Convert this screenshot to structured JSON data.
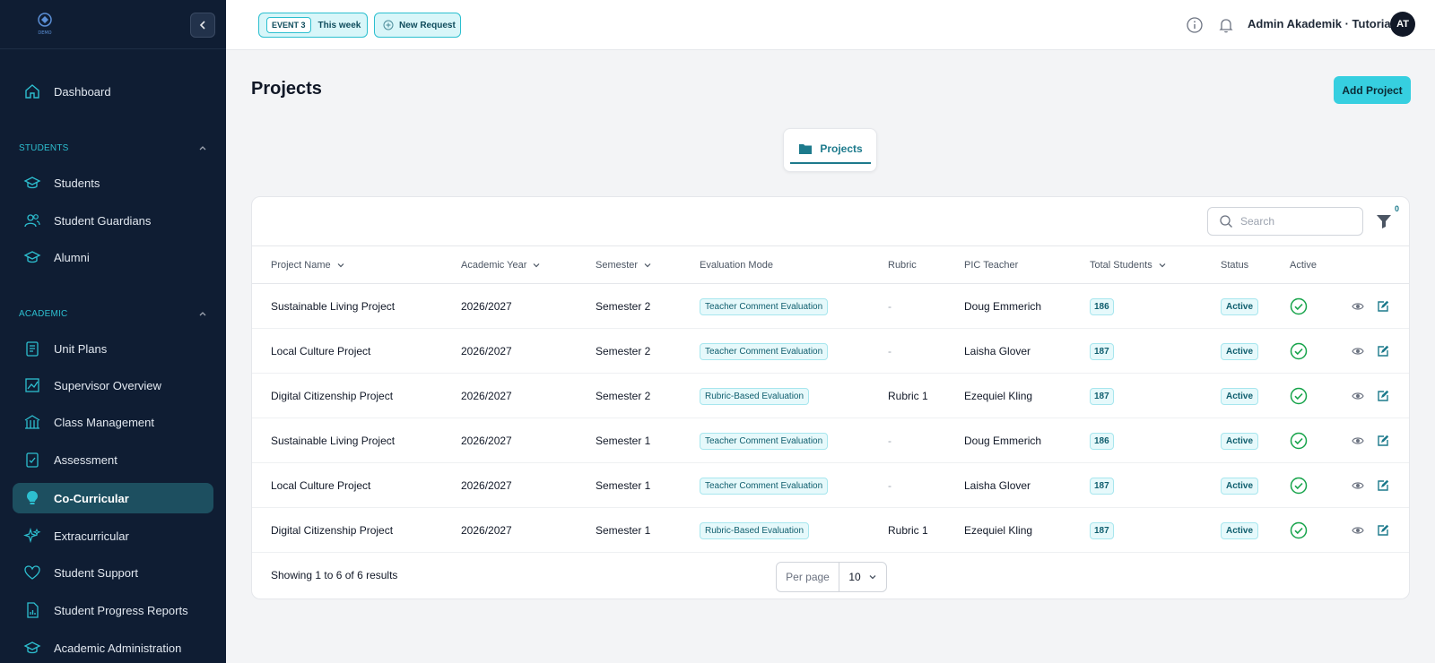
{
  "app": {
    "logo_text": "DEMO"
  },
  "sidebar": {
    "dashboard": "Dashboard",
    "students_section": "STUDENTS",
    "students_items": [
      "Students",
      "Student Guardians",
      "Alumni"
    ],
    "academic_section": "ACADEMIC",
    "academic_items": [
      "Unit Plans",
      "Supervisor Overview",
      "Class Management",
      "Assessment",
      "Co-Curricular",
      "Extracurricular",
      "Student Support",
      "Student Progress Reports",
      "Academic Administration"
    ],
    "active_item": "Co-Curricular"
  },
  "topbar": {
    "event_tag": "EVENT 3",
    "event_label": "This week",
    "new_request": "New Request",
    "user_name": "Admin Akademik · Tutorial",
    "avatar_initials": "AT"
  },
  "page": {
    "title": "Projects",
    "add_button": "Add Project",
    "tab_label": "Projects"
  },
  "toolbar": {
    "search_placeholder": "Search",
    "filter_count": "0"
  },
  "table": {
    "headers": {
      "project_name": "Project Name",
      "academic_year": "Academic Year",
      "semester": "Semester",
      "evaluation_mode": "Evaluation Mode",
      "rubric": "Rubric",
      "pic_teacher": "PIC Teacher",
      "total_students": "Total Students",
      "status": "Status",
      "active": "Active"
    },
    "rows": [
      {
        "project_name": "Sustainable Living Project",
        "academic_year": "2026/2027",
        "semester": "Semester 2",
        "evaluation_mode": "Teacher Comment Evaluation",
        "rubric": "-",
        "pic_teacher": "Doug Emmerich",
        "total_students": "186",
        "status": "Active"
      },
      {
        "project_name": "Local Culture Project",
        "academic_year": "2026/2027",
        "semester": "Semester 2",
        "evaluation_mode": "Teacher Comment Evaluation",
        "rubric": "-",
        "pic_teacher": "Laisha Glover",
        "total_students": "187",
        "status": "Active"
      },
      {
        "project_name": "Digital Citizenship Project",
        "academic_year": "2026/2027",
        "semester": "Semester 2",
        "evaluation_mode": "Rubric-Based Evaluation",
        "rubric": "Rubric 1",
        "pic_teacher": "Ezequiel Kling",
        "total_students": "187",
        "status": "Active"
      },
      {
        "project_name": "Sustainable Living Project",
        "academic_year": "2026/2027",
        "semester": "Semester 1",
        "evaluation_mode": "Teacher Comment Evaluation",
        "rubric": "-",
        "pic_teacher": "Doug Emmerich",
        "total_students": "186",
        "status": "Active"
      },
      {
        "project_name": "Local Culture Project",
        "academic_year": "2026/2027",
        "semester": "Semester 1",
        "evaluation_mode": "Teacher Comment Evaluation",
        "rubric": "-",
        "pic_teacher": "Laisha Glover",
        "total_students": "187",
        "status": "Active"
      },
      {
        "project_name": "Digital Citizenship Project",
        "academic_year": "2026/2027",
        "semester": "Semester 1",
        "evaluation_mode": "Rubric-Based Evaluation",
        "rubric": "Rubric 1",
        "pic_teacher": "Ezequiel Kling",
        "total_students": "187",
        "status": "Active"
      }
    ]
  },
  "footer": {
    "results_text": "Showing 1 to 6 of 6 results",
    "per_page_label": "Per page",
    "per_page_value": "10"
  },
  "colors": {
    "sidebar_bg": "#0f1d33",
    "accent": "#36cfe0",
    "active_nav": "#1d4f60",
    "check_green": "#16a34a"
  }
}
